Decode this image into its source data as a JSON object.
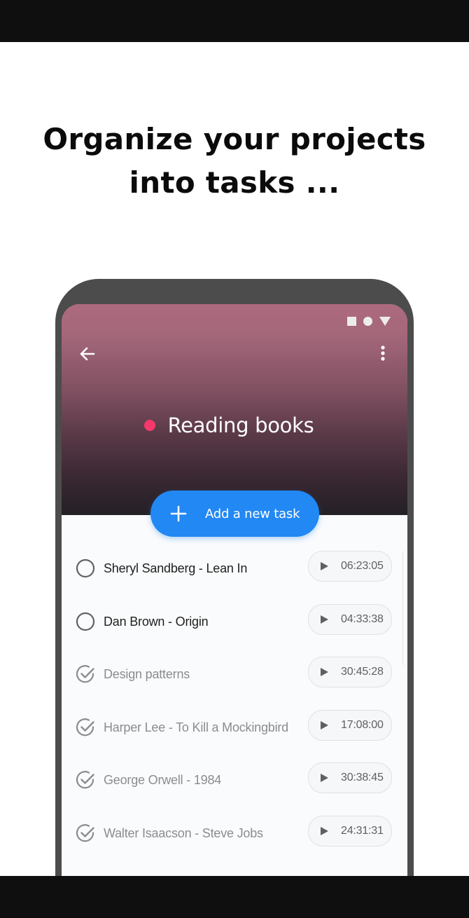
{
  "headline": {
    "line1": "Organize your projects",
    "line2": "into tasks ..."
  },
  "status_bar": {
    "icons": [
      "square-icon",
      "circle-icon",
      "triangle-icon"
    ],
    "color": "#ececec"
  },
  "app_bar": {
    "back_icon": "arrow-back-icon",
    "menu_icon": "more-vert-icon"
  },
  "project": {
    "title": "Reading books",
    "dot_color": "#f7386c"
  },
  "add_task": {
    "label": "Add a new task",
    "icon": "plus-icon",
    "color": "#2288f4"
  },
  "tasks": [
    {
      "name": "Sheryl Sandberg - Lean In",
      "time": "06:23:05",
      "done": false
    },
    {
      "name": "Dan Brown - Origin",
      "time": "04:33:38",
      "done": false
    },
    {
      "name": "Design patterns",
      "time": "30:45:28",
      "done": true
    },
    {
      "name": "Harper Lee - To Kill a Mockingbird",
      "time": "17:08:00",
      "done": true
    },
    {
      "name": "George Orwell - 1984",
      "time": "30:38:45",
      "done": true
    },
    {
      "name": "Walter Isaacson - Steve Jobs",
      "time": "24:31:31",
      "done": true
    }
  ]
}
